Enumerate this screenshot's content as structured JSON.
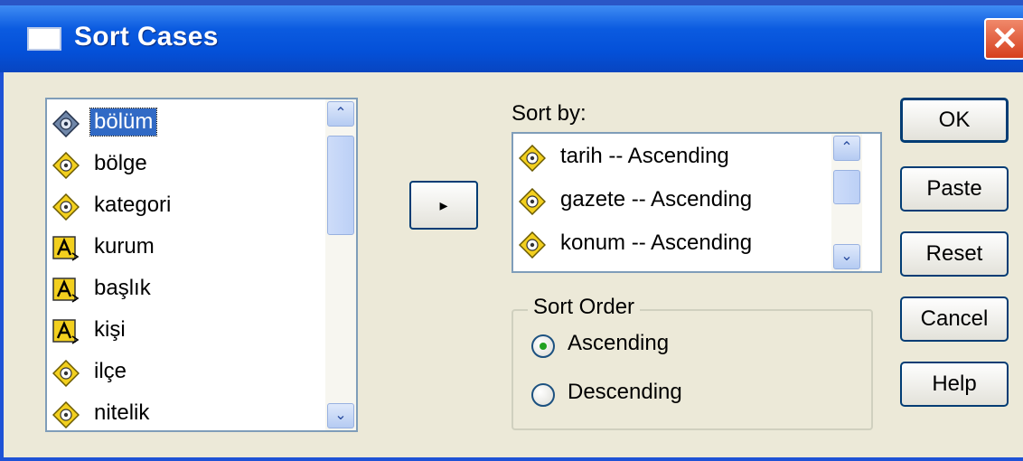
{
  "window": {
    "title": "Sort Cases",
    "close_glyph": "✕"
  },
  "variables": [
    {
      "label": "bölüm",
      "type": "numeric",
      "icon": "numeric-variable-icon",
      "selected": true
    },
    {
      "label": "bölge",
      "type": "numeric",
      "icon": "numeric-variable-icon",
      "selected": false
    },
    {
      "label": "kategori",
      "type": "numeric",
      "icon": "numeric-variable-icon",
      "selected": false
    },
    {
      "label": "kurum",
      "type": "string",
      "icon": "string-variable-icon",
      "selected": false
    },
    {
      "label": "başlık",
      "type": "string",
      "icon": "string-variable-icon",
      "selected": false
    },
    {
      "label": "kişi",
      "type": "string",
      "icon": "string-variable-icon",
      "selected": false
    },
    {
      "label": "ilçe",
      "type": "numeric",
      "icon": "numeric-variable-icon",
      "selected": false
    },
    {
      "label": "nitelik",
      "type": "numeric",
      "icon": "numeric-variable-icon",
      "selected": false
    }
  ],
  "move_button": {
    "glyph": "▸",
    "icon": "right-arrow-icon"
  },
  "sort_by": {
    "label": "Sort by:",
    "items": [
      {
        "label": "tarih -- Ascending",
        "icon": "numeric-variable-icon"
      },
      {
        "label": "gazete -- Ascending",
        "icon": "numeric-variable-icon"
      },
      {
        "label": "konum -- Ascending",
        "icon": "numeric-variable-icon"
      }
    ]
  },
  "sort_order": {
    "label": "Sort Order",
    "options": [
      {
        "label": "Ascending",
        "checked": true
      },
      {
        "label": "Descending",
        "checked": false
      }
    ]
  },
  "buttons": {
    "ok": "OK",
    "paste": "Paste",
    "reset": "Reset",
    "cancel": "Cancel",
    "help": "Help"
  },
  "scroll": {
    "up_glyph": "⌃",
    "down_glyph": "⌄"
  },
  "colors": {
    "titlebar": "#0450d8",
    "selection": "#316ac5",
    "dialog_bg": "#ece9d8"
  }
}
